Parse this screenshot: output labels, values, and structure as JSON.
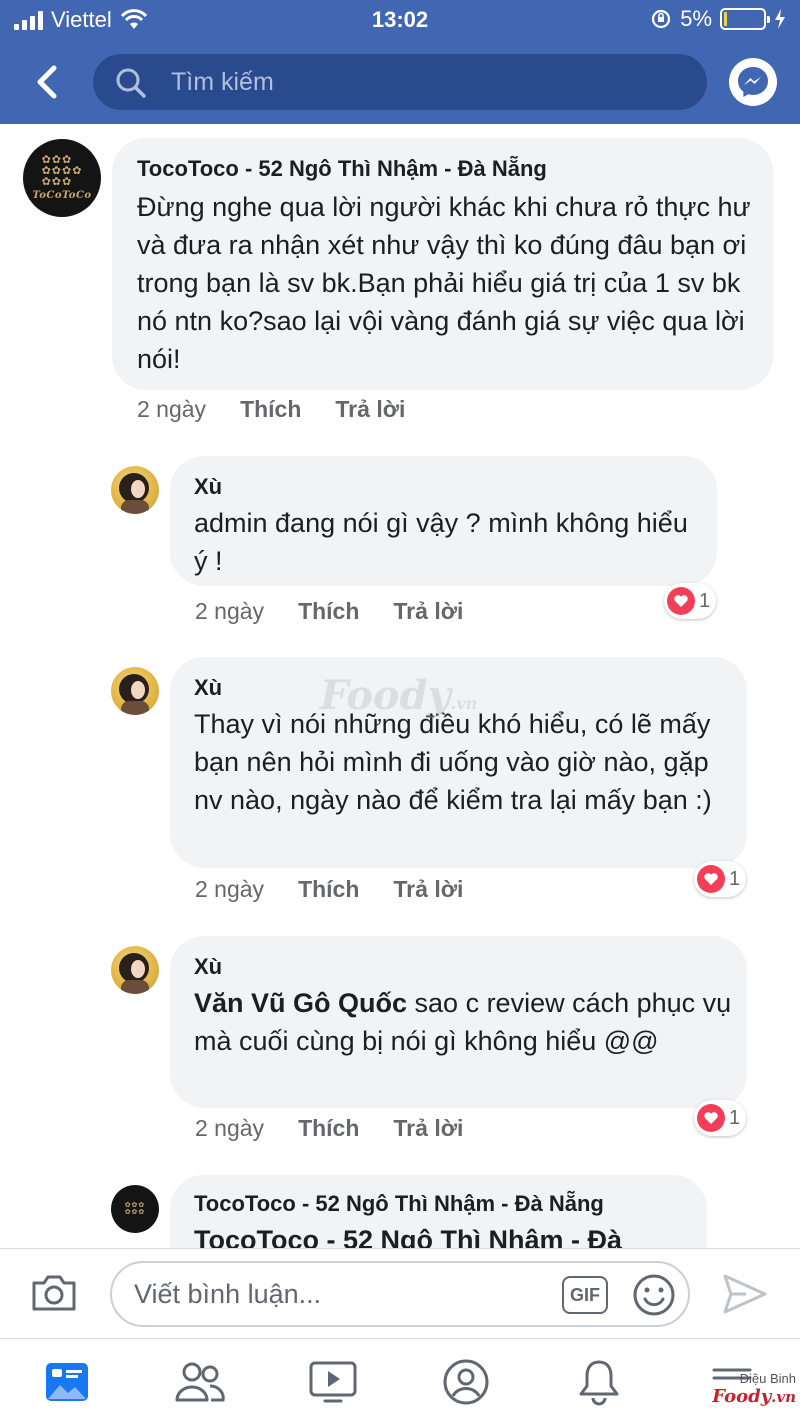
{
  "status_bar": {
    "carrier": "Viettel",
    "time": "13:02",
    "battery": "5%"
  },
  "header": {
    "search_placeholder": "Tìm kiếm"
  },
  "watermark": {
    "text": "Foody",
    "suffix": ".vn"
  },
  "comments": [
    {
      "author": "TocoToco - 52 Ngô Thì Nhậm - Đà Nẵng",
      "text": "Đừng nghe qua lời người khác khi chưa rỏ thực hư và đưa ra nhận xét như vậy thì ko đúng đâu bạn ơi trong bạn là sv bk.Bạn phải hiểu giá trị của 1 sv bk nó ntn ko?sao lại vội vàng đánh giá sự việc qua lời nói!",
      "time": "2 ngày",
      "like": "Thích",
      "reply": "Trả lời"
    },
    {
      "author": "Xù",
      "text": "admin đang nói gì vậy ? mình không hiểu ý !",
      "time": "2 ngày",
      "like": "Thích",
      "reply": "Trả lời",
      "reaction_count": "1"
    },
    {
      "author": "Xù",
      "text": "Thay vì nói những điều khó hiểu, có lẽ mấy bạn nên hỏi mình đi uống vào giờ nào, gặp nv nào, ngày nào để kiểm tra lại mấy bạn :)",
      "time": "2 ngày",
      "like": "Thích",
      "reply": "Trả lời",
      "reaction_count": "1"
    },
    {
      "author": "Xù",
      "mention": "Văn Vũ Gô Quốc",
      "text": " sao c review cách phục vụ mà cuối cùng  bị nói gì không hiểu @@",
      "time": "2 ngày",
      "like": "Thích",
      "reply": "Trả lời",
      "reaction_count": "1"
    },
    {
      "author": "TocoToco - 52 Ngô Thì Nhậm - Đà Nẵng",
      "mention": "TocoToco - 52 Ngô Thì Nhậm - Đà"
    }
  ],
  "avatar_brand": "ToCoToCo",
  "composer": {
    "placeholder": "Viết bình luận...",
    "gif_label": "GIF"
  },
  "tabbar": {
    "tabs": [
      "news-feed",
      "friends",
      "watch",
      "profile",
      "notifications",
      "menu"
    ],
    "brand_line1": "Điệu Binh",
    "brand_line2": "Foody",
    "brand_suffix": ".vn"
  }
}
